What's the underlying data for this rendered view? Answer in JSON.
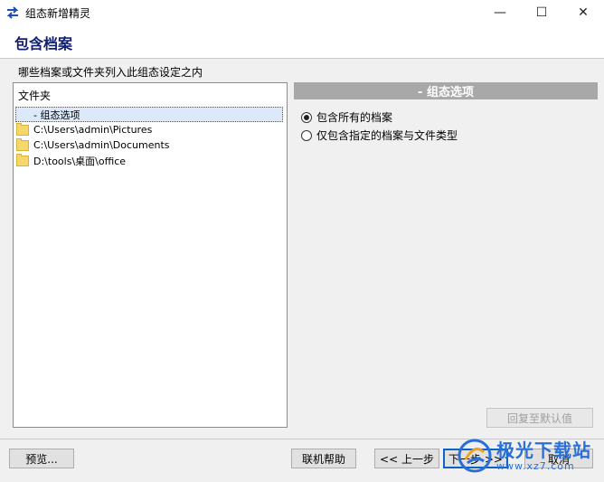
{
  "window": {
    "title": "组态新增精灵",
    "controls": {
      "minimize": "—",
      "maximize": "☐",
      "close": "✕"
    }
  },
  "header": {
    "title": "包含档案"
  },
  "instruction": "哪些档案或文件夹列入此组态设定之内",
  "tree": {
    "header": "文件夹",
    "root": "- 组态选项",
    "items": [
      {
        "path": "C:\\Users\\admin\\Pictures",
        "icon": "folder-icon"
      },
      {
        "path": "C:\\Users\\admin\\Documents",
        "icon": "folder-icon"
      },
      {
        "path": "D:\\tools\\桌面\\office",
        "icon": "folder-icon"
      }
    ]
  },
  "options": {
    "header": "- 组态选项",
    "radio_all": "包含所有的档案",
    "radio_specific": "仅包含指定的档案与文件类型",
    "selected": "radio_all"
  },
  "buttons": {
    "restore_default": "回复至默认值",
    "preview": "预览...",
    "help": "联机帮助",
    "back": "<< 上一步",
    "next": "下一步 >>",
    "cancel": "取消"
  },
  "watermark": {
    "main": "极光下载站",
    "sub": "www.xz7.com"
  },
  "colors": {
    "title_blue": "#0f1e6e",
    "options_header": "#a8a8a8",
    "selection": "#dbe9fa"
  }
}
